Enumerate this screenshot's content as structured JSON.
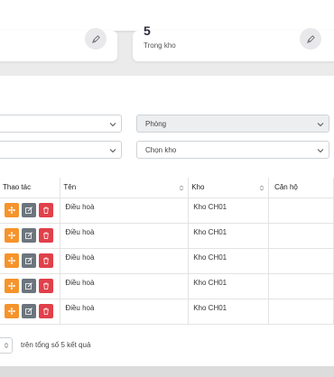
{
  "stats": [
    {
      "value": "",
      "label": ""
    },
    {
      "value": "5",
      "label": "Trong kho"
    }
  ],
  "filters": {
    "select1": "",
    "select2": "",
    "room": "Phòng",
    "warehouse": "Chọn kho"
  },
  "table": {
    "headers": [
      "Thao tác",
      "Tên",
      "Kho",
      "Căn hộ"
    ],
    "rows": [
      {
        "name": "Điều hoà",
        "warehouse": "Kho CH01",
        "apartment": ""
      },
      {
        "name": "Điều hoà",
        "warehouse": "Kho CH01",
        "apartment": ""
      },
      {
        "name": "Điều hoà",
        "warehouse": "Kho CH01",
        "apartment": ""
      },
      {
        "name": "Điều hoà",
        "warehouse": "Kho CH01",
        "apartment": ""
      },
      {
        "name": "Điều hoà",
        "warehouse": "Kho CH01",
        "apartment": ""
      }
    ]
  },
  "footer": {
    "summary": "trên tổng số 5 kết quả"
  },
  "colors": {
    "move": "#f6932a",
    "edit": "#6c757d",
    "delete": "#e0404a"
  }
}
